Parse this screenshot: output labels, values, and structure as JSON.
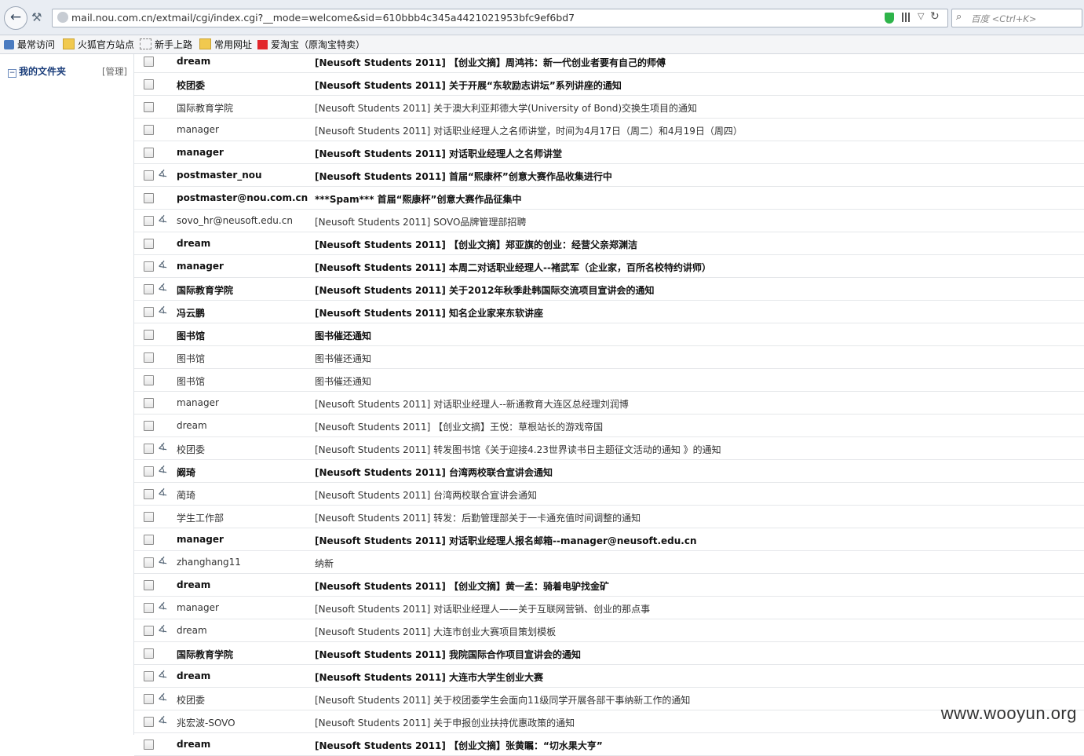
{
  "browser": {
    "url": "mail.nou.com.cn/extmail/cgi/index.cgi?__mode=welcome&sid=610bbb4c345a4421021953bfc9ef6bd7",
    "search_placeholder": "百度 <Ctrl+K>",
    "bookmarks": [
      "最常访问",
      "火狐官方站点",
      "新手上路",
      "常用网址",
      "爱淘宝（原淘宝特卖）"
    ]
  },
  "sidebar": {
    "folder_label": "我的文件夹",
    "manage_label": "[管理]",
    "folder_toggle": "−"
  },
  "messages": [
    {
      "from": "dream",
      "subject": "[Neusoft Students 2011] 【创业文摘】周鸿祎：新一代创业者要有自己的师傅",
      "unread": true,
      "attachment": false
    },
    {
      "from": "校团委",
      "subject": "[Neusoft Students 2011] 关于开展“东软励志讲坛”系列讲座的通知",
      "unread": true,
      "attachment": false
    },
    {
      "from": "国际教育学院",
      "subject": "[Neusoft Students 2011] 关于澳大利亚邦德大学(University of Bond)交换生项目的通知",
      "unread": false,
      "attachment": false
    },
    {
      "from": "manager",
      "subject": "[Neusoft Students 2011] 对话职业经理人之名师讲堂，时间为4月17日（周二）和4月19日（周四）",
      "unread": false,
      "attachment": false
    },
    {
      "from": "manager",
      "subject": "[Neusoft Students 2011] 对话职业经理人之名师讲堂",
      "unread": true,
      "attachment": false
    },
    {
      "from": "postmaster_nou",
      "subject": "[Neusoft Students 2011] 首届“熙康杯”创意大赛作品收集进行中",
      "unread": true,
      "attachment": true
    },
    {
      "from": "postmaster@nou.com.cn",
      "subject": "***Spam*** 首届“熙康杯”创意大赛作品征集中",
      "unread": true,
      "attachment": false
    },
    {
      "from": "sovo_hr@neusoft.edu.cn",
      "subject": "[Neusoft Students 2011] SOVO品牌管理部招聘",
      "unread": false,
      "attachment": true
    },
    {
      "from": "dream",
      "subject": "[Neusoft Students 2011] 【创业文摘】郑亚旗的创业：经营父亲郑渊洁",
      "unread": true,
      "attachment": false
    },
    {
      "from": "manager",
      "subject": "[Neusoft Students 2011] 本周二对话职业经理人--褚武军（企业家，百所名校特约讲师）",
      "unread": true,
      "attachment": true
    },
    {
      "from": "国际教育学院",
      "subject": "[Neusoft Students 2011] 关于2012年秋季赴韩国际交流项目宣讲会的通知",
      "unread": true,
      "attachment": true
    },
    {
      "from": "冯云鹏",
      "subject": "[Neusoft Students 2011] 知名企业家来东软讲座",
      "unread": true,
      "attachment": true
    },
    {
      "from": "图书馆",
      "subject": "图书催还通知",
      "unread": true,
      "attachment": false
    },
    {
      "from": "图书馆",
      "subject": "图书催还通知",
      "unread": false,
      "attachment": false
    },
    {
      "from": "图书馆",
      "subject": "图书催还通知",
      "unread": false,
      "attachment": false
    },
    {
      "from": "manager",
      "subject": "[Neusoft Students 2011] 对话职业经理人--新通教育大连区总经理刘润博",
      "unread": false,
      "attachment": false
    },
    {
      "from": "dream",
      "subject": "[Neusoft Students 2011] 【创业文摘】王悦：草根站长的游戏帝国",
      "unread": false,
      "attachment": false
    },
    {
      "from": "校团委",
      "subject": "[Neusoft Students 2011] 转发图书馆《关于迎接4.23世界读书日主题征文活动的通知 》的通知",
      "unread": false,
      "attachment": true
    },
    {
      "from": "阚琦",
      "subject": "[Neusoft Students 2011] 台湾两校联合宣讲会通知",
      "unread": true,
      "attachment": true
    },
    {
      "from": "蔺琦",
      "subject": "[Neusoft Students 2011] 台湾两校联合宣讲会通知",
      "unread": false,
      "attachment": true
    },
    {
      "from": "学生工作部",
      "subject": "[Neusoft Students 2011] 转发：后勤管理部关于一卡通充值时间调整的通知",
      "unread": false,
      "attachment": false
    },
    {
      "from": "manager",
      "subject": "[Neusoft Students 2011] 对话职业经理人报名邮箱--manager@neusoft.edu.cn",
      "unread": true,
      "attachment": false
    },
    {
      "from": "zhanghang11",
      "subject": "纳新",
      "unread": false,
      "attachment": true
    },
    {
      "from": "dream",
      "subject": "[Neusoft Students 2011] 【创业文摘】黄一孟：骑着电驴找金矿",
      "unread": true,
      "attachment": false
    },
    {
      "from": "manager",
      "subject": "[Neusoft Students 2011] 对话职业经理人——关于互联网营销、创业的那点事",
      "unread": false,
      "attachment": true
    },
    {
      "from": "dream",
      "subject": "[Neusoft Students 2011] 大连市创业大赛项目策划模板",
      "unread": false,
      "attachment": true
    },
    {
      "from": "国际教育学院",
      "subject": "[Neusoft Students 2011] 我院国际合作项目宣讲会的通知",
      "unread": true,
      "attachment": false
    },
    {
      "from": "dream",
      "subject": "[Neusoft Students 2011] 大连市大学生创业大赛",
      "unread": true,
      "attachment": true
    },
    {
      "from": "校团委",
      "subject": "[Neusoft Students 2011] 关于校团委学生会面向11级同学开展各部干事纳新工作的通知",
      "unread": false,
      "attachment": true
    },
    {
      "from": "兆宏波-SOVO",
      "subject": "[Neusoft Students 2011] 关于申报创业扶持优惠政策的通知",
      "unread": false,
      "attachment": true
    },
    {
      "from": "dream",
      "subject": "[Neusoft Students 2011] 【创业文摘】张黄瞩：“切水果大亨”",
      "unread": true,
      "attachment": false
    }
  ],
  "watermark": "www.wooyun.org"
}
